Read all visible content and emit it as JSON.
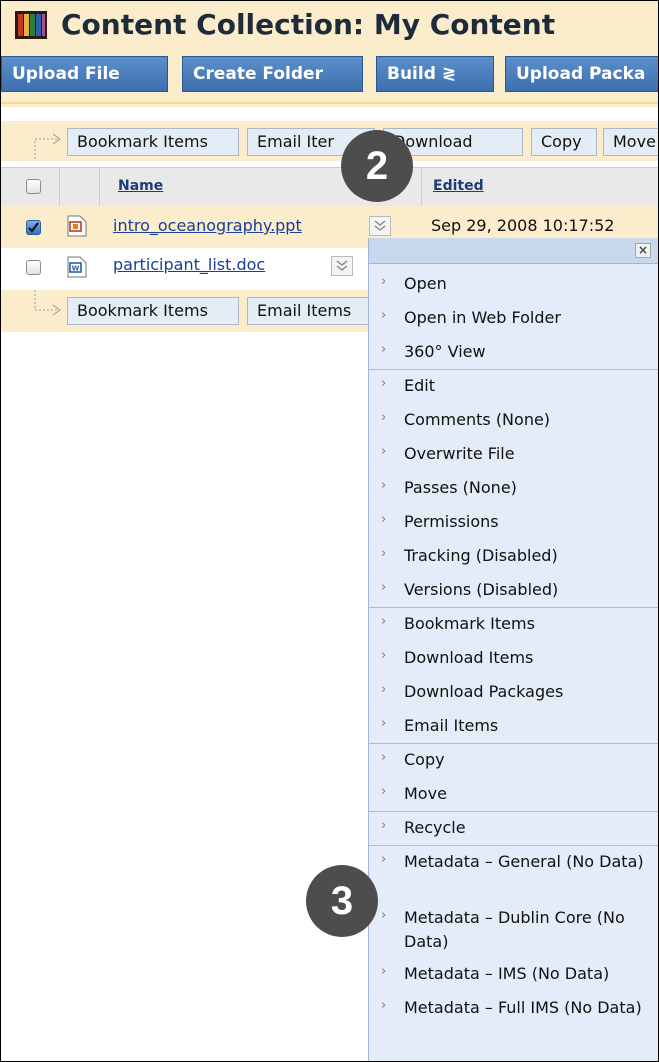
{
  "header": {
    "title": "Content Collection: My Content",
    "buttons": [
      "Upload File",
      "Create Folder",
      "Build ≷",
      "Upload Packa"
    ]
  },
  "top_action_bar": [
    "Bookmark Items",
    "Email Iter",
    "Download",
    "Copy",
    "Move"
  ],
  "columns": {
    "name": "Name",
    "edited": "Edited"
  },
  "files": [
    {
      "name": "intro_oceanography.ppt",
      "edited": "Sep 29, 2008 10:17:52",
      "checked": true,
      "icon": "powerpoint-file-icon"
    },
    {
      "name": "participant_list.doc",
      "edited": "",
      "checked": false,
      "icon": "word-file-icon"
    }
  ],
  "bottom_action_bar": [
    "Bookmark Items",
    "Email Items"
  ],
  "menu": {
    "close_label": "×",
    "groups": [
      [
        "Open",
        "Open in Web Folder",
        "360° View"
      ],
      [
        "Edit",
        "Comments (None)",
        "Overwrite File",
        "Passes (None)",
        "Permissions",
        "Tracking (Disabled)",
        "Versions (Disabled)"
      ],
      [
        "Bookmark Items",
        "Download Items",
        "Download Packages",
        "Email Items"
      ],
      [
        "Copy",
        "Move"
      ],
      [
        "Recycle"
      ],
      [
        "Metadata – General (No Data)",
        "Metadata – Dublin Core (No Data)",
        "Metadata – IMS (No Data)",
        "Metadata – Full IMS (No Data)"
      ]
    ]
  },
  "callouts": [
    "2",
    "3"
  ],
  "colors": {
    "header_bg": "#fbeccb",
    "button_blue": "#4a7dbd",
    "menu_bg": "#e3ecf8"
  }
}
